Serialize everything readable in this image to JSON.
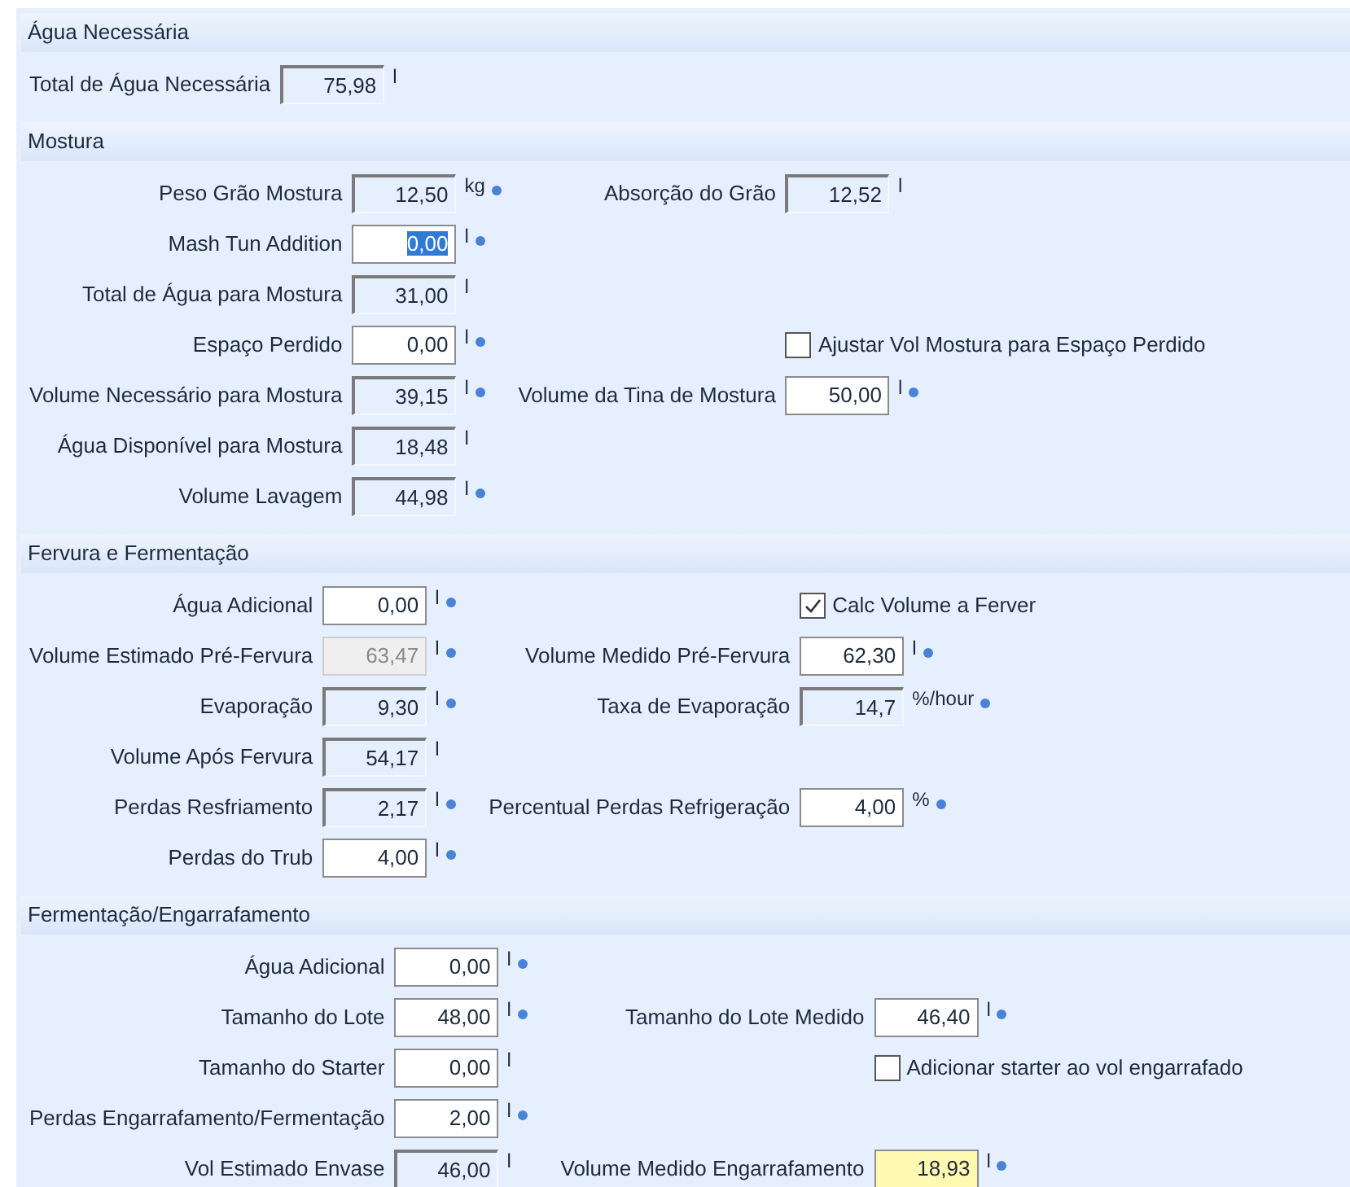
{
  "sections": [
    {
      "title": "Água Necessária",
      "rows": [
        {
          "left": {
            "kind": "readonly",
            "label": "Total de Água Necessária",
            "value": "75,98",
            "unit": "l",
            "info": false,
            "value_selected": false
          }
        }
      ]
    },
    {
      "title": "Mostura",
      "rows": [
        {
          "left": {
            "kind": "readonly",
            "label": "Peso Grão Mostura",
            "value": "12,50",
            "unit": "kg",
            "info": true,
            "value_selected": false
          },
          "right": {
            "kind": "readonly",
            "label": "Absorção do Grão",
            "value": "12,52",
            "unit": "l",
            "info": false,
            "value_selected": false
          }
        },
        {
          "left": {
            "kind": "input",
            "label": "Mash Tun Addition",
            "value": "0,00",
            "unit": "l",
            "info": true,
            "value_selected": true
          }
        },
        {
          "left": {
            "kind": "readonly",
            "label": "Total de Água para Mostura",
            "value": "31,00",
            "unit": "l",
            "info": false,
            "value_selected": false
          }
        },
        {
          "left": {
            "kind": "input",
            "label": "Espaço Perdido",
            "value": "0,00",
            "unit": "l",
            "info": true,
            "value_selected": false
          },
          "right": {
            "kind": "checkbox",
            "label": "Ajustar Vol Mostura para Espaço Perdido",
            "checked": false
          }
        },
        {
          "left": {
            "kind": "readonly",
            "label": "Volume Necessário para Mostura",
            "value": "39,15",
            "unit": "l",
            "info": true,
            "value_selected": false
          },
          "right": {
            "kind": "input",
            "label": "Volume da Tina de Mostura",
            "value": "50,00",
            "unit": "l",
            "info": true,
            "value_selected": false
          }
        },
        {
          "left": {
            "kind": "readonly",
            "label": "Água Disponível para Mostura",
            "value": "18,48",
            "unit": "l",
            "info": false,
            "value_selected": false
          }
        },
        {
          "left": {
            "kind": "readonly",
            "label": "Volume Lavagem",
            "value": "44,98",
            "unit": "l",
            "info": true,
            "value_selected": false
          }
        }
      ]
    },
    {
      "title": "Fervura e Fermentação",
      "rows": [
        {
          "left": {
            "kind": "input",
            "label": "Água Adicional",
            "value": "0,00",
            "unit": "l",
            "info": true,
            "value_selected": false
          },
          "right": {
            "kind": "checkbox",
            "label": "Calc Volume a Ferver",
            "checked": true
          }
        },
        {
          "left": {
            "kind": "disabled",
            "label": "Volume Estimado Pré-Fervura",
            "value": "63,47",
            "unit": "l",
            "info": true,
            "value_selected": false
          },
          "right": {
            "kind": "input",
            "label": "Volume Medido Pré-Fervura",
            "value": "62,30",
            "unit": "l",
            "info": true,
            "value_selected": false
          }
        },
        {
          "left": {
            "kind": "readonly",
            "label": "Evaporação",
            "value": "9,30",
            "unit": "l",
            "info": true,
            "value_selected": false
          },
          "right": {
            "kind": "readonly",
            "label": "Taxa de Evaporação",
            "value": "14,7",
            "unit": "%/hour",
            "info": true,
            "value_selected": false
          }
        },
        {
          "left": {
            "kind": "readonly",
            "label": "Volume Após Fervura",
            "value": "54,17",
            "unit": "l",
            "info": false,
            "value_selected": false
          }
        },
        {
          "left": {
            "kind": "readonly",
            "label": "Perdas Resfriamento",
            "value": "2,17",
            "unit": "l",
            "info": true,
            "value_selected": false
          },
          "right": {
            "kind": "input",
            "label": "Percentual Perdas Refrigeração",
            "value": "4,00",
            "unit": "%",
            "info": true,
            "value_selected": false
          }
        },
        {
          "left": {
            "kind": "input",
            "label": "Perdas do Trub",
            "value": "4,00",
            "unit": "l",
            "info": true,
            "value_selected": false
          }
        }
      ]
    },
    {
      "title": "Fermentação/Engarrafamento",
      "rows": [
        {
          "left": {
            "kind": "input",
            "label": "Água Adicional",
            "value": "0,00",
            "unit": "l",
            "info": true,
            "value_selected": false
          }
        },
        {
          "left": {
            "kind": "input",
            "label": "Tamanho do Lote",
            "value": "48,00",
            "unit": "l",
            "info": true,
            "value_selected": false
          },
          "right": {
            "kind": "input",
            "label": "Tamanho do Lote Medido",
            "value": "46,40",
            "unit": "l",
            "info": true,
            "value_selected": false
          }
        },
        {
          "left": {
            "kind": "input",
            "label": "Tamanho do Starter",
            "value": "0,00",
            "unit": "l",
            "info": false,
            "value_selected": false
          },
          "right": {
            "kind": "checkbox",
            "label": "Adicionar starter ao vol engarrafado",
            "checked": false
          }
        },
        {
          "left": {
            "kind": "input",
            "label": "Perdas Engarrafamento/Fermentação",
            "value": "2,00",
            "unit": "l",
            "info": true,
            "value_selected": false
          }
        },
        {
          "left": {
            "kind": "readonly",
            "label": "Vol Estimado Envase",
            "value": "46,00",
            "unit": "l",
            "info": false,
            "value_selected": false
          },
          "right": {
            "kind": "highlighted",
            "label": "Volume Medido Engarrafamento",
            "value": "18,93",
            "unit": "l",
            "info": true,
            "value_selected": false
          }
        }
      ]
    }
  ]
}
